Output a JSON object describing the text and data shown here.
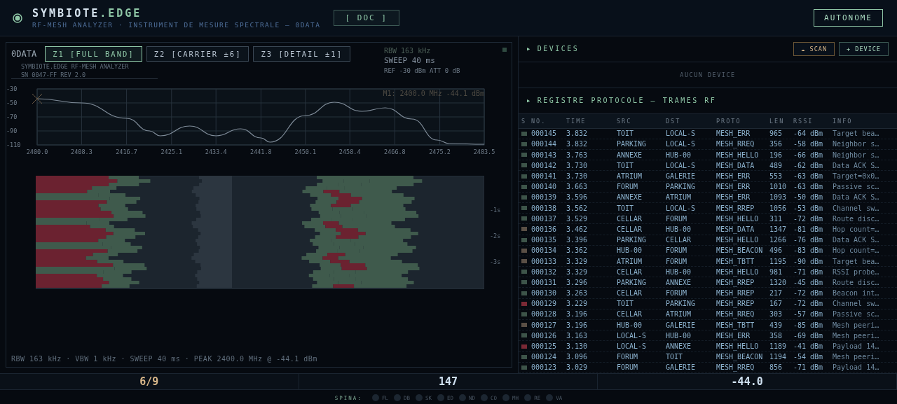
{
  "header": {
    "brand": "SYMBIOTE",
    "brand_suffix": ".EDGE",
    "subtitle": "RF-MESH ANALYZER · INSTRUMENT DE MESURE SPECTRALE — 0DATA",
    "doc_button": "[ DOC ]",
    "mode_button": "AUTONOME"
  },
  "analyzer": {
    "overlay_label": "0DATA",
    "zoom_tabs": [
      {
        "label": "Z1 [FULL BAND]",
        "selected": true
      },
      {
        "label": "Z2 [CARRIER ±6]",
        "selected": false
      },
      {
        "label": "Z3 [DETAIL ±1]",
        "selected": false
      }
    ],
    "device_lines": [
      "SYMBIOTE.EDGE  RF-MESH ANALYZER",
      "SN 0047-FF  REV 2.0"
    ],
    "rbw": "RBW 163 kHz",
    "sweep": "SWEEP 40 ms",
    "ref_att": "REF -30 dBm   ATT 0 dB",
    "marker": "M1: 2400.0 MHz  -44.1 dBm",
    "chart_data": {
      "type": "line",
      "grid": true,
      "x": [
        2400,
        2408.3,
        2416.7,
        2421,
        2423,
        2428.5,
        2433.4,
        2438,
        2441.8,
        2443.5,
        2450.1,
        2455.5,
        2460.7,
        2465,
        2470,
        2474.7,
        2477,
        2483.5
      ],
      "series": [
        {
          "color": "#7f8c99",
          "values": [
            -44,
            -50,
            -72,
            -90,
            -97,
            -83,
            -97,
            -87,
            -100,
            -106,
            -68,
            -49,
            -62,
            -57,
            -73,
            -103,
            -108,
            -109
          ]
        }
      ],
      "xlim": [
        2400,
        2483.5
      ],
      "ylim": [
        -110,
        -30
      ],
      "xticks": [
        {
          "value": 2400,
          "label": "2400.0"
        },
        {
          "value": 2408.3,
          "label": "2408.3"
        },
        {
          "value": 2416.7,
          "label": "2416.7"
        },
        {
          "value": 2425.1,
          "label": "2425.1"
        },
        {
          "value": 2433.4,
          "label": "2433.4"
        },
        {
          "value": 2441.8,
          "label": "2441.8"
        },
        {
          "value": 2450.1,
          "label": "2450.1"
        },
        {
          "value": 2458.4,
          "label": "2458.4"
        },
        {
          "value": 2466.8,
          "label": "2466.8"
        },
        {
          "value": 2475.2,
          "label": "2475.2"
        },
        {
          "value": 2483.5,
          "label": "2483.5"
        }
      ],
      "yticks": [
        -30,
        -50,
        -70,
        -90,
        -110
      ]
    },
    "waterfall_labels": [
      "-1s",
      "-2s",
      "-3s"
    ],
    "footer": "RBW 163 kHz · VBW 1 kHz · SWEEP 40 ms · PEAK 2400.0 MHz @ -44.1 dBm"
  },
  "devices": {
    "marker": "▶",
    "title": "DEVICES",
    "scan_icon": "☁",
    "scan_button": "SCAN",
    "add_button": "+ DEVICE",
    "empty": "AUCUN DEVICE"
  },
  "log": {
    "marker": "▶",
    "title": "REGISTRE PROTOCOLE — TRAMES RF",
    "columns": [
      "S",
      "NO.",
      "TIME",
      "SRC",
      "DST",
      "PROTO",
      "LEN",
      "RSSI",
      "INFO"
    ],
    "rows": [
      {
        "color": "#3d5449",
        "no": "000145",
        "time": "3.832",
        "src": "TOIT",
        "dst": "LOCAL-S",
        "proto": "MESH_ERR",
        "len": "965",
        "rssi": "-64 dBm",
        "info": "Target bea…"
      },
      {
        "color": "#3d5449",
        "no": "000144",
        "time": "3.832",
        "src": "PARKING",
        "dst": "LOCAL-S",
        "proto": "MESH_RREQ",
        "len": "356",
        "rssi": "-58 dBm",
        "info": "Neighbor s…"
      },
      {
        "color": "#3d5449",
        "no": "000143",
        "time": "3.763",
        "src": "ANNEXE",
        "dst": "HUB-00",
        "proto": "MESH_HELLO",
        "len": "196",
        "rssi": "-66 dBm",
        "info": "Neighbor s…"
      },
      {
        "color": "#3d5449",
        "no": "000142",
        "time": "3.730",
        "src": "TOIT",
        "dst": "LOCAL-S",
        "proto": "MESH_DATA",
        "len": "489",
        "rssi": "-62 dBm",
        "info": "Data ACK S…"
      },
      {
        "color": "#3d5449",
        "no": "000141",
        "time": "3.730",
        "src": "ATRIUM",
        "dst": "GALERIE",
        "proto": "MESH_ERR",
        "len": "553",
        "rssi": "-63 dBm",
        "info": "Target=0x0…"
      },
      {
        "color": "#3d5449",
        "no": "000140",
        "time": "3.663",
        "src": "FORUM",
        "dst": "PARKING",
        "proto": "MESH_ERR",
        "len": "1010",
        "rssi": "-63 dBm",
        "info": "Passive sc…"
      },
      {
        "color": "#3d5449",
        "no": "000139",
        "time": "3.596",
        "src": "ANNEXE",
        "dst": "ATRIUM",
        "proto": "MESH_ERR",
        "len": "1093",
        "rssi": "-50 dBm",
        "info": "Data ACK S…"
      },
      {
        "color": "#3d5449",
        "no": "000138",
        "time": "3.562",
        "src": "TOIT",
        "dst": "LOCAL-S",
        "proto": "MESH_RREP",
        "len": "1056",
        "rssi": "-53 dBm",
        "info": "Channel sw…"
      },
      {
        "color": "#3d5449",
        "no": "000137",
        "time": "3.529",
        "src": "CELLAR",
        "dst": "FORUM",
        "proto": "MESH_HELLO",
        "len": "311",
        "rssi": "-72 dBm",
        "info": "Route disc…"
      },
      {
        "color": "#5a4f45",
        "no": "000136",
        "time": "3.462",
        "src": "CELLAR",
        "dst": "HUB-00",
        "proto": "MESH_DATA",
        "len": "1347",
        "rssi": "-81 dBm",
        "info": "Hop count=…"
      },
      {
        "color": "#3d5449",
        "no": "000135",
        "time": "3.396",
        "src": "PARKING",
        "dst": "CELLAR",
        "proto": "MESH_HELLO",
        "len": "1266",
        "rssi": "-76 dBm",
        "info": "Data ACK S…"
      },
      {
        "color": "#5a4f45",
        "no": "000134",
        "time": "3.362",
        "src": "HUB-00",
        "dst": "FORUM",
        "proto": "MESH_BEACON",
        "len": "496",
        "rssi": "-83 dBm",
        "info": "Hop count=…"
      },
      {
        "color": "#5a4f45",
        "no": "000133",
        "time": "3.329",
        "src": "ATRIUM",
        "dst": "FORUM",
        "proto": "MESH_TBTT",
        "len": "1195",
        "rssi": "-90 dBm",
        "info": "Target bea…"
      },
      {
        "color": "#3d5449",
        "no": "000132",
        "time": "3.329",
        "src": "CELLAR",
        "dst": "HUB-00",
        "proto": "MESH_HELLO",
        "len": "981",
        "rssi": "-71 dBm",
        "info": "RSSI probe…"
      },
      {
        "color": "#3d5449",
        "no": "000131",
        "time": "3.296",
        "src": "PARKING",
        "dst": "ANNEXE",
        "proto": "MESH_RREP",
        "len": "1320",
        "rssi": "-45 dBm",
        "info": "Route disc…"
      },
      {
        "color": "#3d5449",
        "no": "000130",
        "time": "3.263",
        "src": "CELLAR",
        "dst": "FORUM",
        "proto": "MESH_RREP",
        "len": "217",
        "rssi": "-72 dBm",
        "info": "Beacon int…"
      },
      {
        "color": "#7a2935",
        "no": "000129",
        "time": "3.229",
        "src": "TOIT",
        "dst": "PARKING",
        "proto": "MESH_RREP",
        "len": "167",
        "rssi": "-72 dBm",
        "info": "Channel sw…"
      },
      {
        "color": "#3d5449",
        "no": "000128",
        "time": "3.196",
        "src": "CELLAR",
        "dst": "ATRIUM",
        "proto": "MESH_RREQ",
        "len": "303",
        "rssi": "-57 dBm",
        "info": "Passive sc…"
      },
      {
        "color": "#5a4f45",
        "no": "000127",
        "time": "3.196",
        "src": "HUB-00",
        "dst": "GALERIE",
        "proto": "MESH_TBTT",
        "len": "439",
        "rssi": "-85 dBm",
        "info": "Mesh peeri…"
      },
      {
        "color": "#3d5449",
        "no": "000126",
        "time": "3.163",
        "src": "LOCAL-S",
        "dst": "HUB-00",
        "proto": "MESH_ERR",
        "len": "358",
        "rssi": "-69 dBm",
        "info": "Mesh peeri…"
      },
      {
        "color": "#7a2935",
        "no": "000125",
        "time": "3.130",
        "src": "LOCAL-S",
        "dst": "ANNEXE",
        "proto": "MESH_HELLO",
        "len": "1189",
        "rssi": "-41 dBm",
        "info": "Payload 14…"
      },
      {
        "color": "#3d5449",
        "no": "000124",
        "time": "3.096",
        "src": "FORUM",
        "dst": "TOIT",
        "proto": "MESH_BEACON",
        "len": "1194",
        "rssi": "-54 dBm",
        "info": "Mesh peeri…"
      },
      {
        "color": "#3d5449",
        "no": "000123",
        "time": "3.029",
        "src": "FORUM",
        "dst": "GALERIE",
        "proto": "MESH_RREQ",
        "len": "856",
        "rssi": "-71 dBm",
        "info": "Payload 14…"
      }
    ]
  },
  "stats": [
    {
      "value": "6/9",
      "kind": "warn"
    },
    {
      "value": "147",
      "kind": "normal"
    },
    {
      "value": "-44.0",
      "kind": "normal"
    }
  ],
  "spina": {
    "label": "SPINA:",
    "nodes": [
      "FL",
      "DB",
      "SK",
      "ED",
      "ND",
      "CO",
      "MH",
      "RE",
      "VA"
    ]
  }
}
